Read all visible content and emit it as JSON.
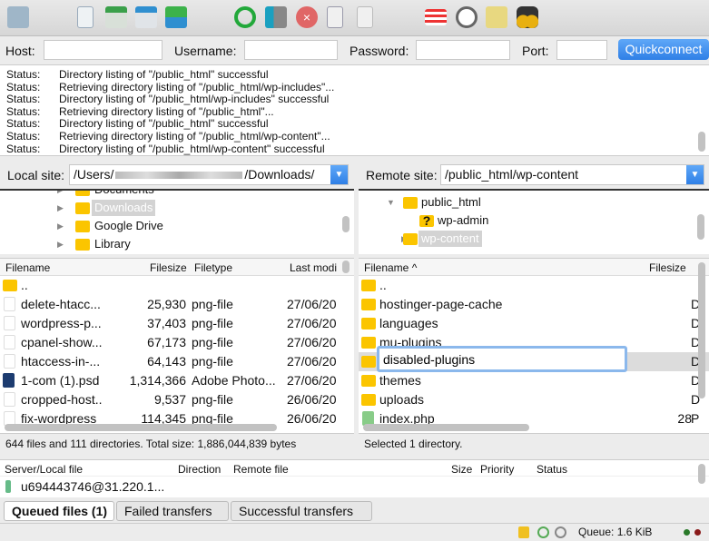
{
  "toolbar": {
    "icons": [
      "site-manager-icon",
      "message-log-icon",
      "local-tree-icon",
      "remote-tree-icon",
      "transfer-queue-icon",
      "refresh-icon",
      "process-queue-icon",
      "cancel-icon",
      "disconnect-icon",
      "reconnect-icon",
      "directory-listing-filters-icon",
      "compare-icon",
      "sync-browse-icon",
      "search-icon"
    ]
  },
  "quickconnect": {
    "host_label": "Host:",
    "host_value": "",
    "username_label": "Username:",
    "username_value": "",
    "password_label": "Password:",
    "password_value": "",
    "port_label": "Port:",
    "port_value": "",
    "button": "Quickconnect",
    "accent": "#2f7fe6"
  },
  "log": [
    {
      "label": "Status:",
      "text": "Directory listing of \"/public_html\" successful"
    },
    {
      "label": "Status:",
      "text": "Retrieving directory listing of \"/public_html/wp-includes\"..."
    },
    {
      "label": "Status:",
      "text": "Directory listing of \"/public_html/wp-includes\" successful"
    },
    {
      "label": "Status:",
      "text": "Retrieving directory listing of \"/public_html\"..."
    },
    {
      "label": "Status:",
      "text": "Directory listing of \"/public_html\" successful"
    },
    {
      "label": "Status:",
      "text": "Retrieving directory listing of \"/public_html/wp-content\"..."
    },
    {
      "label": "Status:",
      "text": "Directory listing of \"/public_html/wp-content\" successful"
    }
  ],
  "local": {
    "site_label": "Local site:",
    "path_start": "/Users/",
    "path_end": "/Downloads/",
    "tree": [
      {
        "name": "Documents"
      },
      {
        "name": "Downloads",
        "selected": true
      },
      {
        "name": "Google Drive"
      },
      {
        "name": "Library"
      }
    ],
    "columns": [
      "Filename",
      "Filesize",
      "Filetype",
      "Last modi"
    ],
    "rows": [
      {
        "name": "..",
        "size": "",
        "type": "",
        "date": "",
        "icon": "folder"
      },
      {
        "name": "delete-htacc...",
        "size": "25,930",
        "type": "png-file",
        "date": "27/06/20",
        "icon": "file"
      },
      {
        "name": "wordpress-p...",
        "size": "37,403",
        "type": "png-file",
        "date": "27/06/20",
        "icon": "file"
      },
      {
        "name": "cpanel-show...",
        "size": "67,173",
        "type": "png-file",
        "date": "27/06/20",
        "icon": "file"
      },
      {
        "name": "htaccess-in-...",
        "size": "64,143",
        "type": "png-file",
        "date": "27/06/20",
        "icon": "file"
      },
      {
        "name": "1-com (1).psd",
        "size": "1,314,366",
        "type": "Adobe Photo...",
        "date": "27/06/20",
        "icon": "psd"
      },
      {
        "name": "cropped-host..",
        "size": "9,537",
        "type": "png-file",
        "date": "26/06/20",
        "icon": "file"
      },
      {
        "name": "fix-wordpress",
        "size": "114,345",
        "type": "png-file",
        "date": "26/06/20",
        "icon": "file"
      }
    ],
    "status": "644 files and 111 directories. Total size: 1,886,044,839 bytes"
  },
  "remote": {
    "site_label": "Remote site:",
    "path": "/public_html/wp-content",
    "tree": [
      {
        "name": "public_html",
        "expanded": true
      },
      {
        "name": "wp-admin",
        "unknown": true
      },
      {
        "name": "wp-content",
        "selected": true
      }
    ],
    "columns": [
      "Filename",
      "Filesize"
    ],
    "sort_icon": "chevron-up-icon",
    "rows": [
      {
        "name": "..",
        "size": "",
        "type": "",
        "icon": "folder"
      },
      {
        "name": "hostinger-page-cache",
        "size": "",
        "type": "D",
        "icon": "folder"
      },
      {
        "name": "languages",
        "size": "",
        "type": "D",
        "icon": "folder"
      },
      {
        "name": "mu-plugins",
        "size": "",
        "type": "D",
        "icon": "folder"
      },
      {
        "name": "",
        "size": "",
        "type": "D",
        "icon": "folder",
        "selected": true
      },
      {
        "name": "themes",
        "size": "",
        "type": "D",
        "icon": "folder"
      },
      {
        "name": "uploads",
        "size": "",
        "type": "D",
        "icon": "folder"
      },
      {
        "name": "index.php",
        "size": "28",
        "type": "P",
        "icon": "php"
      }
    ],
    "rename_value": "disabled-plugins",
    "status": "Selected 1 directory."
  },
  "queue": {
    "columns": [
      "Server/Local file",
      "Direction",
      "Remote file",
      "Size",
      "Priority",
      "Status"
    ],
    "rows": [
      {
        "server": "u694443746@31.220.1..."
      }
    ]
  },
  "tabs": [
    {
      "label": "Queued files (1)",
      "active": true
    },
    {
      "label": "Failed transfers"
    },
    {
      "label": "Successful transfers"
    }
  ],
  "statusbar": {
    "queue": "Queue: 1.6 KiB"
  }
}
